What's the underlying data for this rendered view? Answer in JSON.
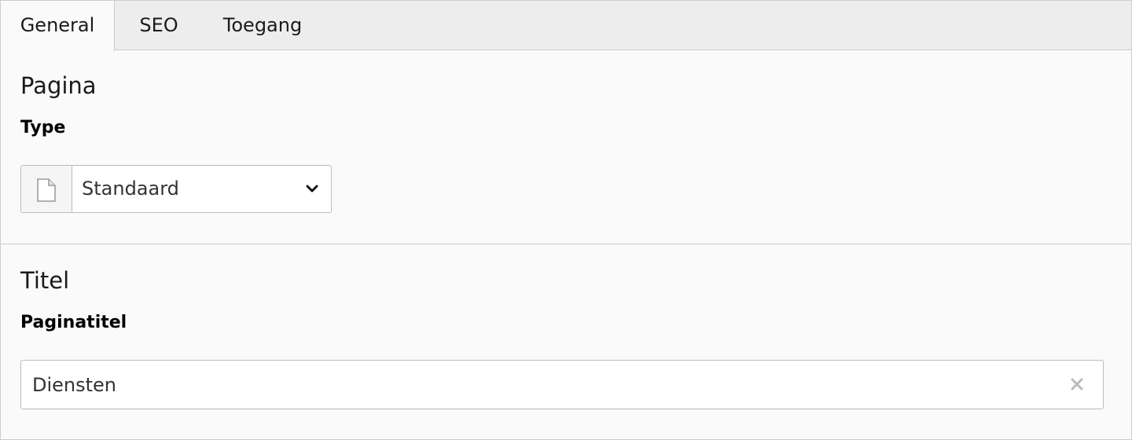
{
  "tabs": [
    {
      "label": "General",
      "active": true
    },
    {
      "label": "SEO",
      "active": false
    },
    {
      "label": "Toegang",
      "active": false
    }
  ],
  "sections": {
    "pagina": {
      "title": "Pagina",
      "field_label": "Type",
      "select_value": "Standaard",
      "select_icon": "page-document-icon"
    },
    "titel": {
      "title": "Titel",
      "field_label": "Paginatitel",
      "input_value": "Diensten",
      "clear_icon": "clear-x-icon"
    }
  }
}
